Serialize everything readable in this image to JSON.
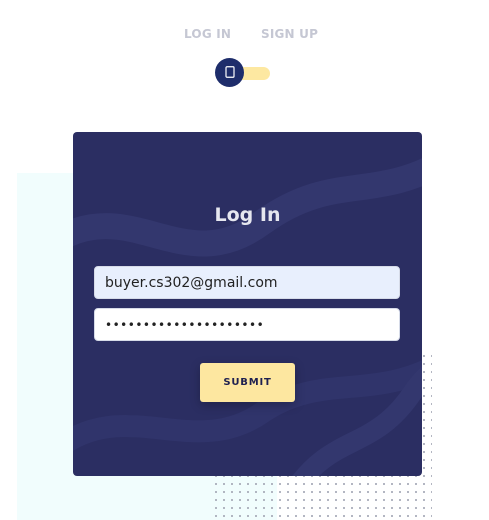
{
  "tabs": {
    "login_label": "LOG IN",
    "signup_label": "SIGN UP"
  },
  "toggle": {
    "state": "login",
    "knob_icon": "phone-icon",
    "knob_color": "#1e2d6b",
    "track_color": "#fde8a1"
  },
  "card": {
    "title": "Log In",
    "background_color": "#2b2e62",
    "email": {
      "value": "buyer.cs302@gmail.com"
    },
    "password": {
      "value": "•••••••••••••••••••••"
    },
    "submit_label": "SUBMIT",
    "submit_color": "#fde7a0"
  }
}
